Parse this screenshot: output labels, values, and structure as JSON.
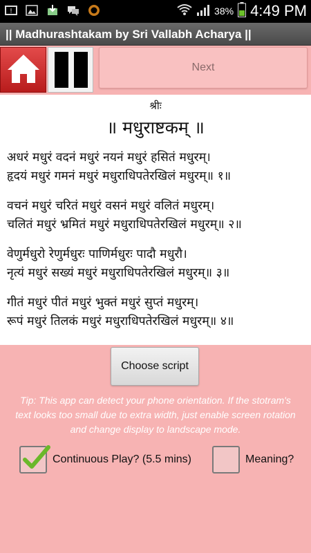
{
  "status_bar": {
    "battery_percent": "38%",
    "time": "4:49 PM",
    "icons": [
      "notification-icon",
      "image-icon",
      "download-icon",
      "chat-icon",
      "circle-app-icon",
      "wifi-icon",
      "signal-icon",
      "battery-icon"
    ]
  },
  "title_bar": {
    "title": "|| Madhurashtakam by Sri Vallabh Acharya ||"
  },
  "toolbar": {
    "next_label": "Next",
    "home_icon": "home-icon",
    "pause_icon": "pause-icon"
  },
  "content": {
    "shri": "श्रीः",
    "heading": "॥ मधुराष्टकम् ॥",
    "verses": [
      [
        "अधरं मधुरं वदनं मधुरं नयनं मधुरं हसितं मधुरम्।",
        "हृदयं मधुरं गमनं मधुरं मधुराधिपतेरखिलं मधुरम्॥ १॥"
      ],
      [
        "वचनं मधुरं चरितं मधुरं वसनं मधुरं वलितं मधुरम्।",
        "चलितं मधुरं भ्रमितं मधुरं मधुराधिपतेरखिलं मधुरम्॥ २॥"
      ],
      [
        "वेणुर्मधुरो रेणुर्मधुरः पाणिर्मधुरः पादौ मधुरौ।",
        "नृत्यं मधुरं सख्यं मधुरं मधुराधिपतेरखिलं मधुरम्॥ ३॥"
      ],
      [
        "गीतं मधुरं पीतं मधुरं भुक्तं मधुरं सुप्तं मधुरम्।",
        "रूपं मधुरं तिलकं मधुरं मधुराधिपतेरखिलं मधुरम्॥ ४॥"
      ]
    ]
  },
  "choose_script_label": "Choose script",
  "tip": "Tip: This app can detect your phone orientation. If the stotram's text looks too small due to extra width, just enable screen rotation and change display to landscape mode.",
  "checkboxes": {
    "continuous_play": {
      "label": "Continuous Play? (5.5 mins)",
      "checked": true
    },
    "meaning": {
      "label": "Meaning?",
      "checked": false
    }
  },
  "colors": {
    "background": "#f7b3b3",
    "home_button": "#c82222",
    "check_green": "#6ab82a"
  }
}
